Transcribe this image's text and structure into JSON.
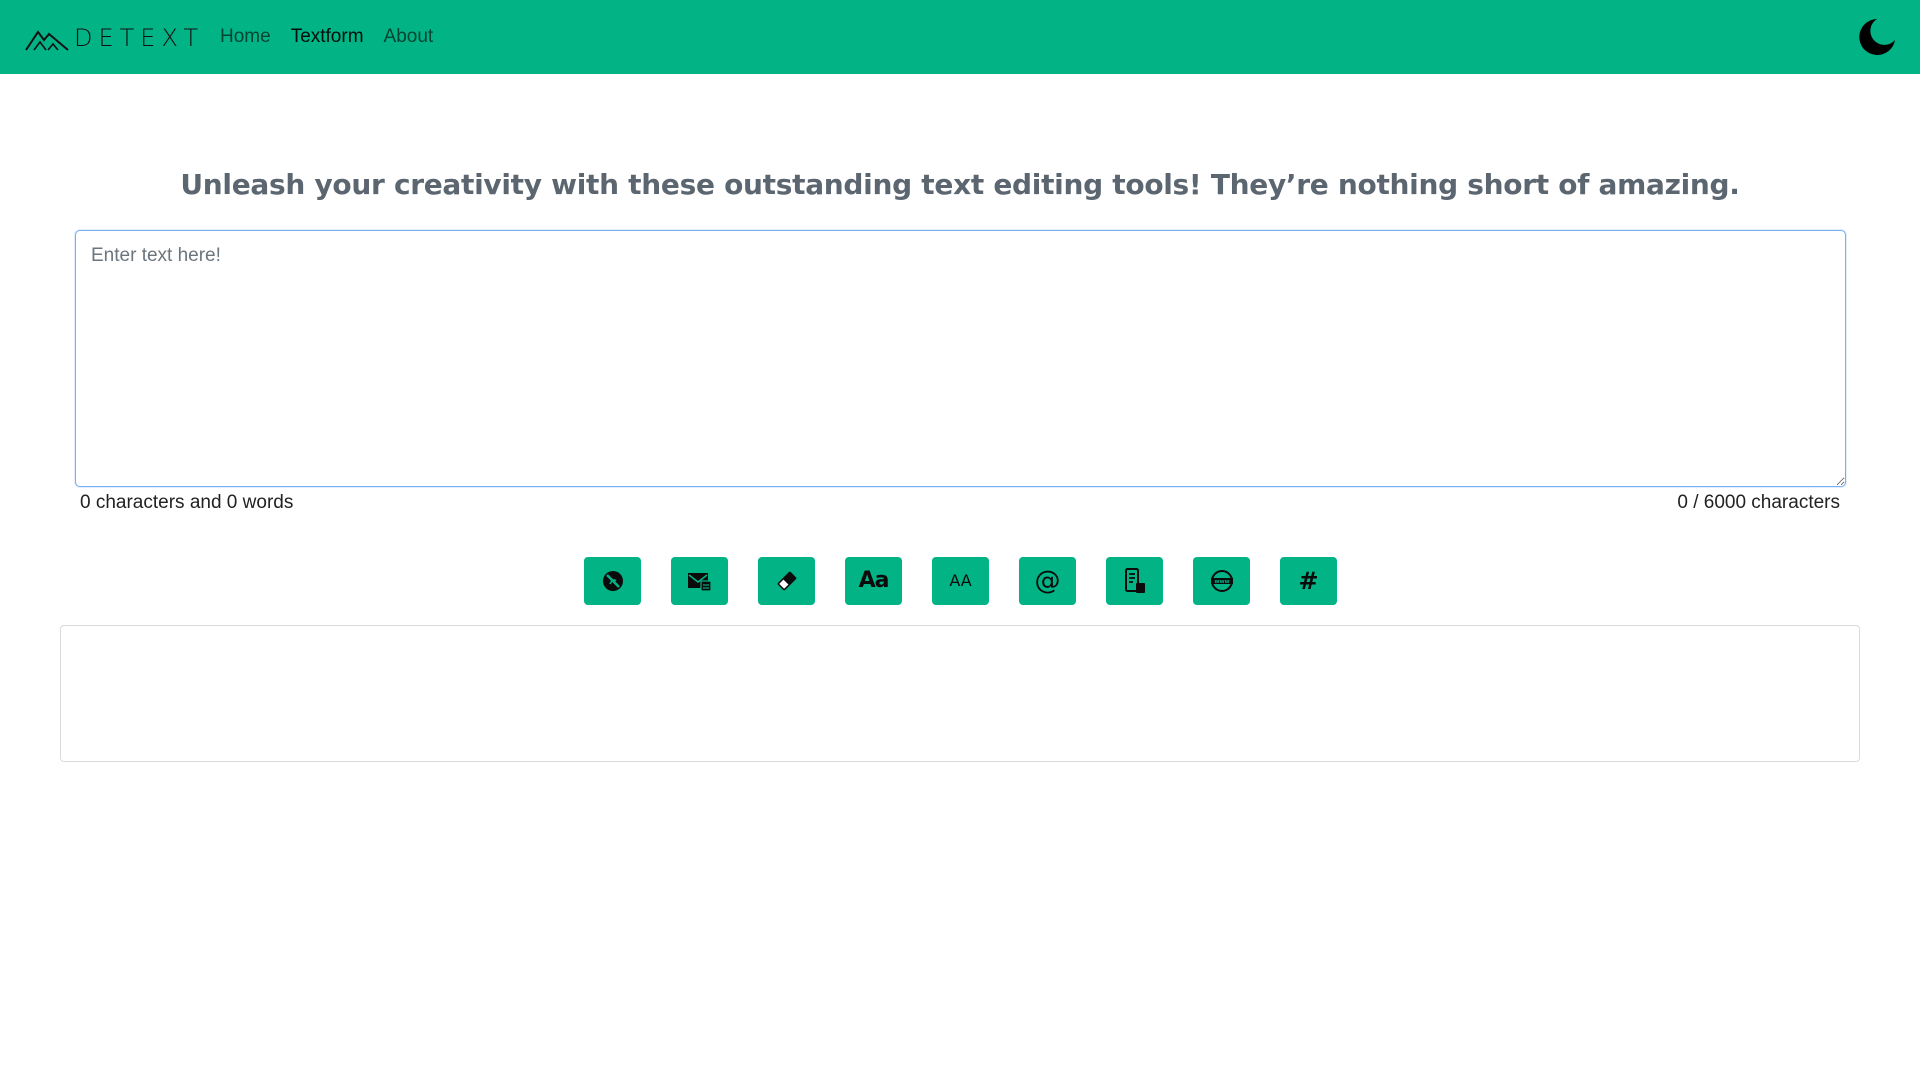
{
  "app": {
    "brand": "DETEXT",
    "accent_color": "#02b386"
  },
  "nav": {
    "items": [
      {
        "label": "Home",
        "active": false
      },
      {
        "label": "Textform",
        "active": true
      },
      {
        "label": "About",
        "active": false
      }
    ],
    "mode_toggle_icon": "moon-icon"
  },
  "main": {
    "heading": "Unleash your creativity with these outstanding text editing tools! They’re nothing short of amazing.",
    "input": {
      "placeholder": "Enter text here!",
      "value": ""
    },
    "stats_left": "0 characters and 0 words",
    "stats_right": "0 / 6000 characters",
    "tools": [
      {
        "icon": "clear-circle-icon"
      },
      {
        "icon": "copy-mail-icon"
      },
      {
        "icon": "eraser-icon"
      },
      {
        "icon": "capitalize-icon",
        "glyph": "Aa"
      },
      {
        "icon": "uppercase-icon",
        "glyph": "AA"
      },
      {
        "icon": "email-extract-icon",
        "glyph": "@"
      },
      {
        "icon": "phone-extract-icon"
      },
      {
        "icon": "url-extract-icon"
      },
      {
        "icon": "hashtag-extract-icon",
        "glyph": "#"
      }
    ],
    "output": ""
  }
}
